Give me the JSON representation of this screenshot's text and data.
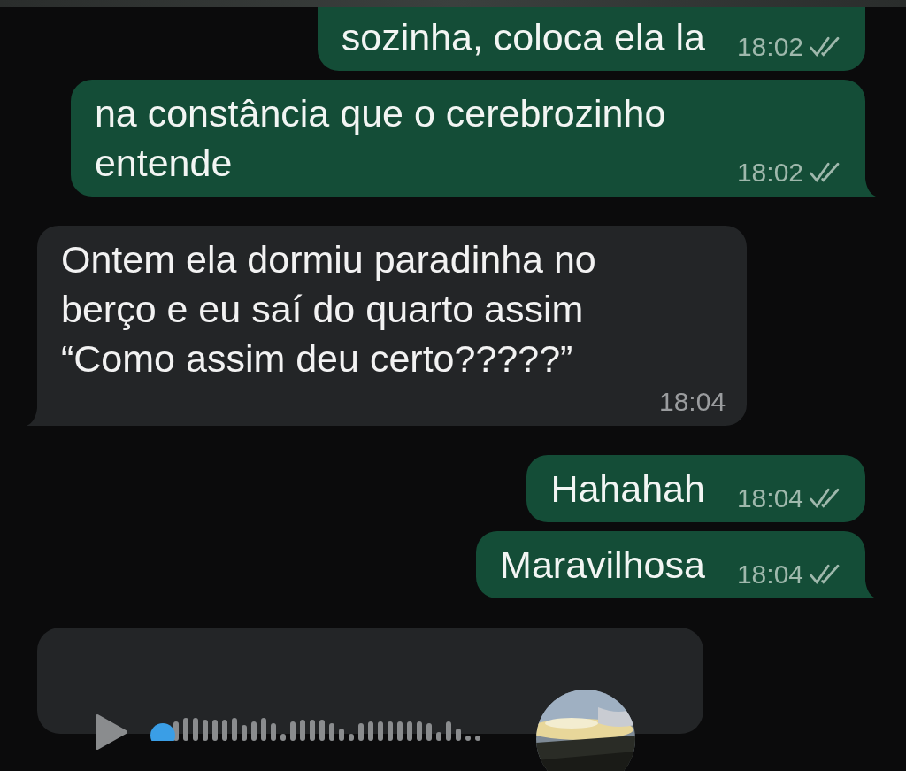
{
  "messages": [
    {
      "kind": "text",
      "outgoing": true,
      "text": "sozinha, coloca ela la",
      "time": "18:02",
      "tail": false,
      "read": false
    },
    {
      "kind": "text",
      "outgoing": true,
      "text": "na constância que o cerebrozinho entende",
      "time": "18:02",
      "tail": true,
      "read": false
    },
    {
      "kind": "text",
      "outgoing": false,
      "text": "Ontem ela dormiu paradinha no berço e eu saí do quarto assim “Como assim deu certo?????”",
      "time": "18:04",
      "tail": true
    },
    {
      "kind": "text",
      "outgoing": true,
      "text": "Hahahah",
      "time": "18:04",
      "tail": false,
      "read": false
    },
    {
      "kind": "text",
      "outgoing": true,
      "text": "Maravilhosa",
      "time": "18:04",
      "tail": true,
      "read": false
    },
    {
      "kind": "voice",
      "outgoing": false,
      "level": 0.0
    }
  ]
}
